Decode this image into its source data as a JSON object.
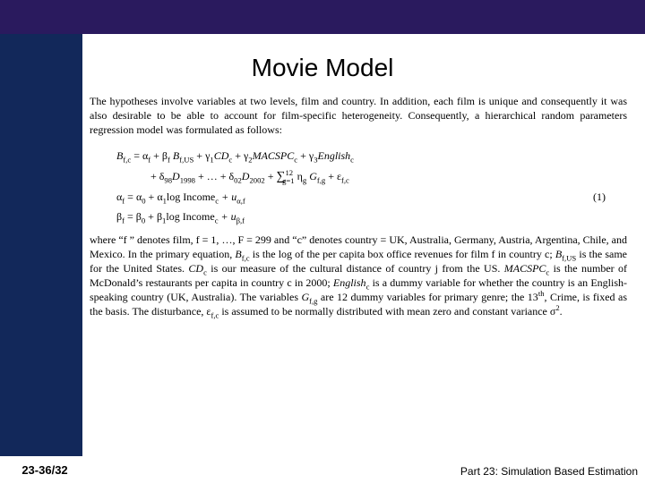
{
  "title": "Movie Model",
  "intro": "The hypotheses involve variables at two levels, film and country. In addition, each film is unique and consequently it was also desirable to be able to account for film-specific heterogeneity. Consequently, a hierarchical random parameters regression model was formulated as follows:",
  "eq": {
    "line1a": "B",
    "line1a_sub": "f,c",
    "line1b": " = α",
    "line1b_sub": "f",
    "line1c": " + β",
    "line1c_sub": "f",
    "line1d": " B",
    "line1d_sub": "f,US",
    "line1e": " + γ",
    "line1e_sub1": "1",
    "line1f": "CD",
    "line1f_sub": "c",
    "line1g": " + γ",
    "line1g_sub": "2",
    "line1h": "MACSPC",
    "line1h_sub": "c",
    "line1i": " + γ",
    "line1i_sub": "3",
    "line1j": "English",
    "line1j_sub": "c",
    "line2a": "+ δ",
    "line2a_sub": "98",
    "line2b": "D",
    "line2b_sub": "1998",
    "line2c": " + … + δ",
    "line2c_sub": "02",
    "line2d": "D",
    "line2d_sub": "2002",
    "line2e": " + ",
    "line2_sumtop": "12",
    "line2_sumbot": "g=1",
    "line2f": " η",
    "line2f_sub": "g",
    "line2g": " G",
    "line2g_sub": "f,g",
    "line2h": " + ε",
    "line2h_sub": "f,c",
    "line3a": "α",
    "line3a_sub": "f",
    "line3b": " = α",
    "line3b_sub": "0",
    "line3c": " + α",
    "line3c_sub": "1",
    "line3d": "log Income",
    "line3d_sub": "c",
    "line3e": " + u",
    "line3e_sub": "α,f",
    "line4a": "β",
    "line4a_sub": "f",
    "line4b": " = β",
    "line4b_sub": "0",
    "line4c": " + β",
    "line4c_sub": "1",
    "line4d": "log Income",
    "line4d_sub": "c",
    "line4e": " + u",
    "line4e_sub": "β,f",
    "eqnum": "(1)"
  },
  "explain_pre": "where “f ” denotes film, f = 1, …, F = 299 and “c” denotes country = UK, Australia, Germany, Austria, Argentina, Chile, and Mexico. In the primary equation, ",
  "explain_Bfc": "B",
  "explain_Bfc_sub": "f,c",
  "explain_mid1": " is the log of the per capita box office revenues for film f in country c; ",
  "explain_BfUS": "B",
  "explain_BfUS_sub": "f,US",
  "explain_mid2": " is the same for the United States. ",
  "explain_CD": "CD",
  "explain_CD_sub": "c",
  "explain_mid3": " is our measure of the cultural distance of country j from the US. ",
  "explain_MAC": "MACSPC",
  "explain_MAC_sub": "c",
  "explain_mid4": " is the number of McDonald’s restaurants per capita in country c in 2000; ",
  "explain_Eng": "English",
  "explain_Eng_sub": "c",
  "explain_mid5": " is a dummy variable for whether the country is an English-speaking country (UK, Australia). The variables ",
  "explain_G": "G",
  "explain_G_sub": "f,g",
  "explain_mid6": " are 12 dummy variables for primary genre; the 13",
  "explain_th": "th",
  "explain_mid7": ", Crime, is fixed as the basis. The disturbance, ε",
  "explain_eps_sub": "f,c",
  "explain_mid8": " is assumed to be normally distributed with mean zero and constant variance σ",
  "explain_sq": "2",
  "explain_end": ".",
  "footer": {
    "page": "23-36/32",
    "part": "Part 23: Simulation Based Estimation"
  }
}
